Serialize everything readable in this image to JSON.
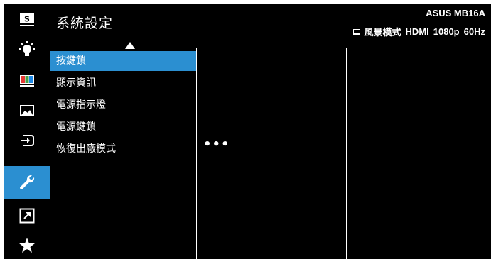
{
  "header": {
    "title": "系統設定",
    "model": "ASUS MB16A",
    "mode": "風景模式",
    "input": "HDMI",
    "resolution": "1080p",
    "refresh": "60Hz"
  },
  "sidebar": {
    "items": [
      {
        "icon": "splendid-icon",
        "active": false
      },
      {
        "icon": "blue-light-filter-icon",
        "active": false
      },
      {
        "icon": "color-icon",
        "active": false
      },
      {
        "icon": "image-icon",
        "active": false
      },
      {
        "icon": "input-select-icon",
        "active": false
      },
      {
        "icon": "system-setup-wrench-icon",
        "active": true
      },
      {
        "icon": "shortcut-icon",
        "active": false
      },
      {
        "icon": "favorite-star-icon",
        "active": false
      }
    ],
    "active_color": "#2b8fd1"
  },
  "menu": {
    "items": [
      {
        "label": "按鍵鎖",
        "active": true
      },
      {
        "label": "顯示資訊",
        "active": false
      },
      {
        "label": "電源指示燈",
        "active": false
      },
      {
        "label": "電源鍵鎖",
        "active": false
      },
      {
        "label": "恢復出廠模式",
        "active": false
      }
    ]
  },
  "submenu": {
    "ellipsis": "•••"
  }
}
